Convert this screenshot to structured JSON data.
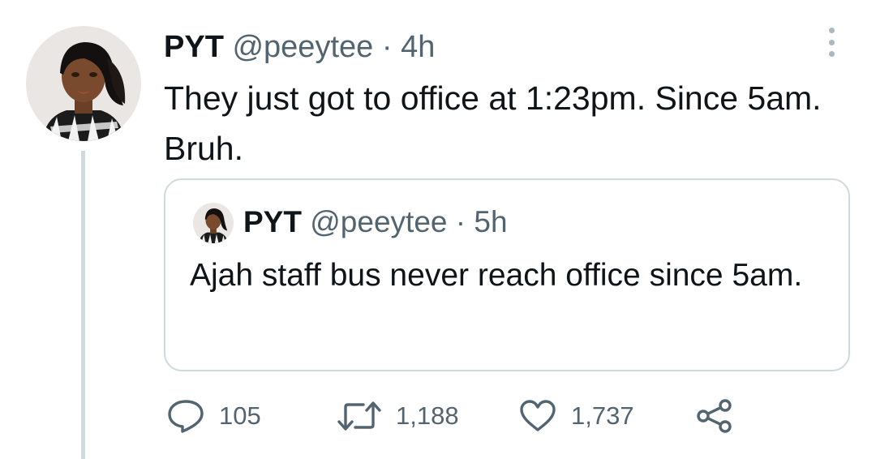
{
  "tweet": {
    "author_name": "PYT",
    "handle": "@peeytee",
    "separator": "·",
    "time": "4h",
    "text": "They just got to office at 1:23pm. Since 5am. Bruh."
  },
  "quoted_tweet": {
    "author_name": "PYT",
    "handle": "@peeytee",
    "separator": "·",
    "time": "5h",
    "text": "Ajah staff bus never reach office since 5am."
  },
  "actions": {
    "replies": "105",
    "retweets": "1,188",
    "likes": "1,737",
    "icons": [
      "reply-icon",
      "retweet-icon",
      "like-icon",
      "share-icon"
    ]
  },
  "colors": {
    "text": "#0f1419",
    "secondary": "#536471",
    "border": "#cfd9de",
    "thread_line": "#cfd9de"
  }
}
